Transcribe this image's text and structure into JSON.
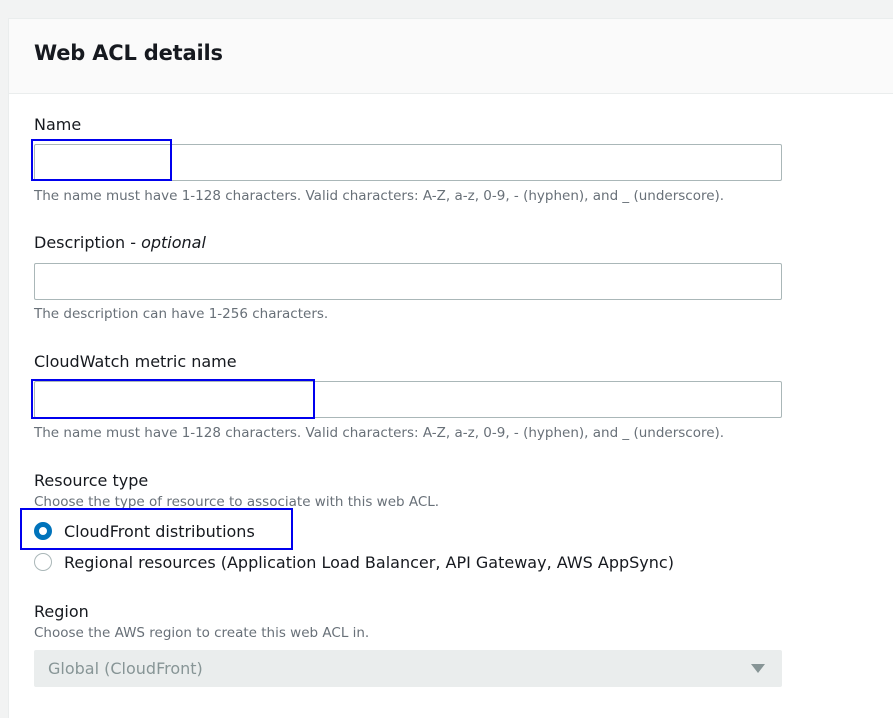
{
  "panel": {
    "title": "Web ACL details"
  },
  "name_field": {
    "label": "Name",
    "value": "",
    "hint": "The name must have 1-128 characters. Valid characters: A-Z, a-z, 0-9, - (hyphen), and _ (underscore)."
  },
  "description_field": {
    "label": "Description - ",
    "label_optional": "optional",
    "value": "",
    "hint": "The description can have 1-256 characters."
  },
  "metric_field": {
    "label": "CloudWatch metric name",
    "value": "",
    "hint": "The name must have 1-128 characters. Valid characters: A-Z, a-z, 0-9, - (hyphen), and _ (underscore)."
  },
  "resource_type": {
    "label": "Resource type",
    "hint": "Choose the type of resource to associate with this web ACL.",
    "options": [
      {
        "label": "CloudFront distributions",
        "selected": true
      },
      {
        "label": "Regional resources (Application Load Balancer, API Gateway, AWS AppSync)",
        "selected": false
      }
    ]
  },
  "region": {
    "label": "Region",
    "hint": "Choose the AWS region to create this web ACL in.",
    "selected_value": "Global (CloudFront)",
    "disabled": true
  },
  "colors": {
    "accent": "#0073bb",
    "highlight_box": "#0000ee",
    "hint_text": "#687078"
  }
}
